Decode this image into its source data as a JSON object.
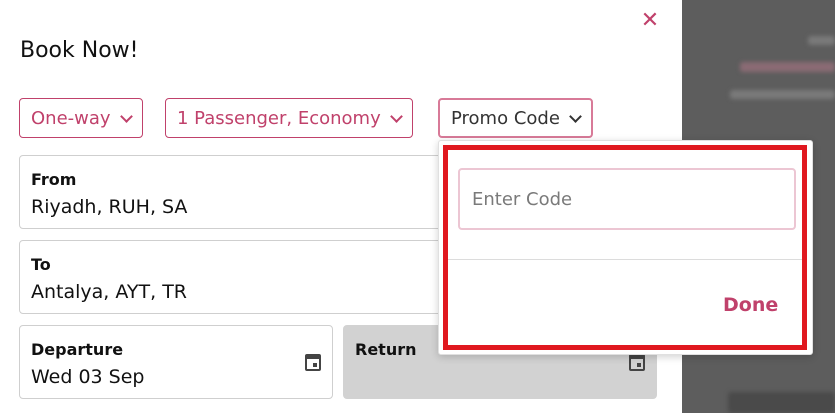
{
  "modal": {
    "close_icon": "close-icon",
    "title": "Book Now!"
  },
  "options": {
    "trip_type": "One-way",
    "passengers": "1 Passenger, Economy",
    "promo": "Promo Code"
  },
  "fields": {
    "from": {
      "label": "From",
      "value": "Riyadh, RUH, SA"
    },
    "to": {
      "label": "To",
      "value": "Antalya, AYT, TR"
    },
    "departure": {
      "label": "Departure",
      "value": "Wed 03 Sep"
    },
    "return": {
      "label": "Return",
      "value": ""
    }
  },
  "promo_dropdown": {
    "placeholder": "Enter Code",
    "value": "",
    "done_label": "Done"
  },
  "colors": {
    "accent": "#c0416b",
    "highlight": "#e0181f",
    "backdrop": "#5d5d5d",
    "disabled": "#d2d2d2"
  }
}
